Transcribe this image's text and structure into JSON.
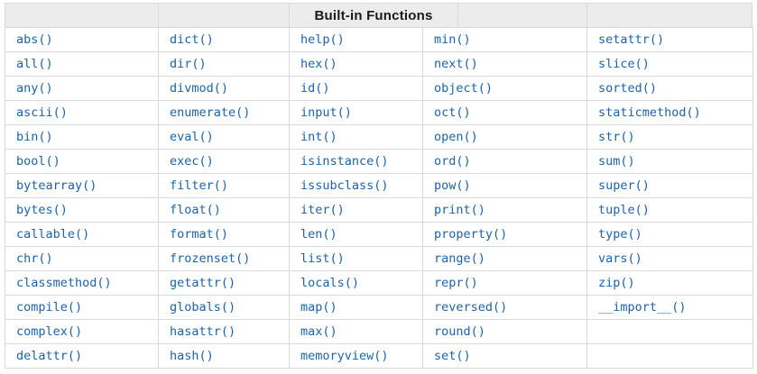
{
  "table": {
    "title": "Built-in Functions",
    "columns": [
      [
        "abs()",
        "all()",
        "any()",
        "ascii()",
        "bin()",
        "bool()",
        "bytearray()",
        "bytes()",
        "callable()",
        "chr()",
        "classmethod()",
        "compile()",
        "complex()",
        "delattr()"
      ],
      [
        "dict()",
        "dir()",
        "divmod()",
        "enumerate()",
        "eval()",
        "exec()",
        "filter()",
        "float()",
        "format()",
        "frozenset()",
        "getattr()",
        "globals()",
        "hasattr()",
        "hash()"
      ],
      [
        "help()",
        "hex()",
        "id()",
        "input()",
        "int()",
        "isinstance()",
        "issubclass()",
        "iter()",
        "len()",
        "list()",
        "locals()",
        "map()",
        "max()",
        "memoryview()"
      ],
      [
        "min()",
        "next()",
        "object()",
        "oct()",
        "open()",
        "ord()",
        "pow()",
        "print()",
        "property()",
        "range()",
        "repr()",
        "reversed()",
        "round()",
        "set()"
      ],
      [
        "setattr()",
        "slice()",
        "sorted()",
        "staticmethod()",
        "str()",
        "sum()",
        "super()",
        "tuple()",
        "type()",
        "vars()",
        "zip()",
        "__import__()",
        "",
        ""
      ]
    ],
    "colors": {
      "link_blue": "#1c63a8",
      "header_background": "#ececec",
      "border_gray": "#d9d9d9",
      "header_text": "#1a1a1a"
    }
  }
}
